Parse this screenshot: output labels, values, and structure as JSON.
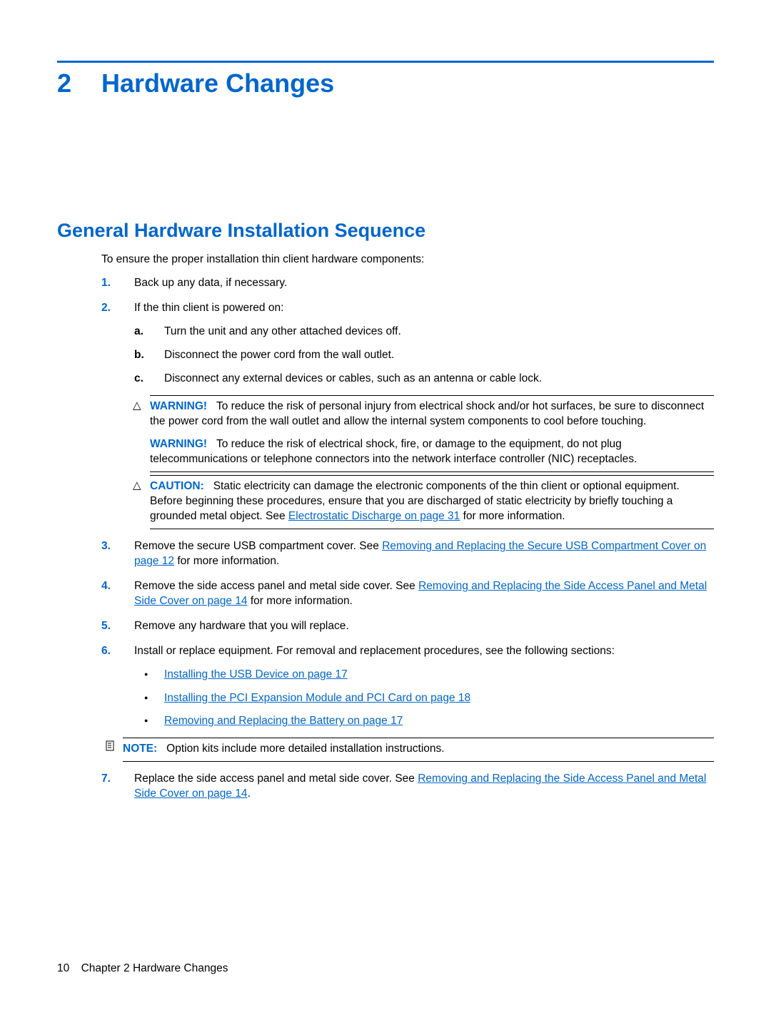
{
  "chapter": {
    "number": "2",
    "title": "Hardware Changes"
  },
  "section_title": "General Hardware Installation Sequence",
  "intro": "To ensure the proper installation thin client hardware components:",
  "steps": {
    "s1_marker": "1.",
    "s1_text": "Back up any data, if necessary.",
    "s2_marker": "2.",
    "s2_text": "If the thin client is powered on:",
    "s2a_marker": "a.",
    "s2a_text": "Turn the unit and any other attached devices off.",
    "s2b_marker": "b.",
    "s2b_text": "Disconnect the power cord from the wall outlet.",
    "s2c_marker": "c.",
    "s2c_text": "Disconnect any external devices or cables, such as an antenna or cable lock.",
    "s3_marker": "3.",
    "s3_pre": "Remove the secure USB compartment cover. See ",
    "s3_link": "Removing and Replacing the Secure USB Compartment Cover on page 12",
    "s3_post": " for more information.",
    "s4_marker": "4.",
    "s4_pre": "Remove the side access panel and metal side cover. See ",
    "s4_link": "Removing and Replacing the Side Access Panel and Metal Side Cover on page 14",
    "s4_post": " for more information.",
    "s5_marker": "5.",
    "s5_text": "Remove any hardware that you will replace.",
    "s6_marker": "6.",
    "s6_text": "Install or replace equipment. For removal and replacement procedures, see the following sections:",
    "s6_b1": "Installing the USB Device on page 17",
    "s6_b2": "Installing the PCI Expansion Module and PCI Card on page 18",
    "s6_b3": "Removing and Replacing the Battery on page 17",
    "s7_marker": "7.",
    "s7_pre": "Replace the side access panel and metal side cover. See ",
    "s7_link": "Removing and Replacing the Side Access Panel and Metal Side Cover on page 14",
    "s7_post": "."
  },
  "callouts": {
    "warn_label": "WARNING!",
    "warn1": "To reduce the risk of personal injury from electrical shock and/or hot surfaces, be sure to disconnect the power cord from the wall outlet and allow the internal system components to cool before touching.",
    "warn2": "To reduce the risk of electrical shock, fire, or damage to the equipment, do not plug telecommunications or telephone connectors into the network interface controller (NIC) receptacles.",
    "caution_label": "CAUTION:",
    "caution_pre": "Static electricity can damage the electronic components of the thin client or optional equipment. Before beginning these procedures, ensure that you are discharged of static electricity by briefly touching a grounded metal object. See ",
    "caution_link": "Electrostatic Discharge on page 31",
    "caution_post": " for more information.",
    "note_label": "NOTE:",
    "note_text": "Option kits include more detailed installation instructions."
  },
  "footer": {
    "page": "10",
    "chapter_text": "Chapter 2   Hardware Changes"
  }
}
